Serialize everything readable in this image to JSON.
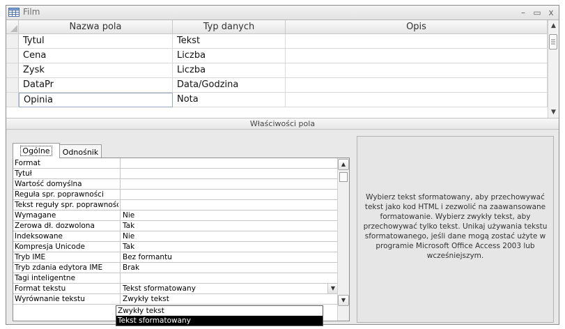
{
  "window": {
    "title": "Film",
    "table_icon": "table-icon",
    "controls": {
      "minimize": "–",
      "restore": "▭",
      "close": "x"
    }
  },
  "grid": {
    "columns": [
      "Nazwa pola",
      "Typ danych",
      "Opis"
    ],
    "rows": [
      {
        "name": "Tytul",
        "type": "Tekst",
        "desc": ""
      },
      {
        "name": "Cena",
        "type": "Liczba",
        "desc": ""
      },
      {
        "name": "Zysk",
        "type": "Liczba",
        "desc": ""
      },
      {
        "name": "DataPr",
        "type": "Data/Godzina",
        "desc": ""
      },
      {
        "name": "Opinia",
        "type": "Nota",
        "desc": ""
      }
    ]
  },
  "properties_bar": "Właściwości pola",
  "tabs": {
    "general": "Ogólne",
    "lookup": "Odnośnik"
  },
  "properties": [
    {
      "label": "Format",
      "value": ""
    },
    {
      "label": "Tytuł",
      "value": ""
    },
    {
      "label": "Wartość domyślna",
      "value": ""
    },
    {
      "label": "Reguła spr. poprawności",
      "value": ""
    },
    {
      "label": "Tekst reguły spr. poprawności",
      "value": ""
    },
    {
      "label": "Wymagane",
      "value": "Nie"
    },
    {
      "label": "Zerowa dł. dozwolona",
      "value": "Tak"
    },
    {
      "label": "Indeksowane",
      "value": "Nie"
    },
    {
      "label": "Kompresja Unicode",
      "value": "Tak"
    },
    {
      "label": "Tryb IME",
      "value": "Bez formantu"
    },
    {
      "label": "Tryb zdania edytora IME",
      "value": "Brak"
    },
    {
      "label": "Tagi inteligentne",
      "value": ""
    },
    {
      "label": "Format tekstu",
      "value": "Tekst sformatowany"
    },
    {
      "label": "Wyrównanie tekstu",
      "value": "Zwykły tekst"
    }
  ],
  "dropdown": {
    "options": [
      "Zwykły tekst",
      "Tekst sformatowany"
    ],
    "selected": "Tekst sformatowany"
  },
  "help_text": "Wybierz tekst sformatowany, aby przechowywać tekst jako kod HTML i zezwolić na zaawansowane formatowanie. Wybierz zwykły tekst, aby przechowywać tylko tekst. Unikaj używania tekstu sformatowanego, jeśli dane mogą zostać użyte w programie Microsoft Office Access 2003 lub wcześniejszym."
}
